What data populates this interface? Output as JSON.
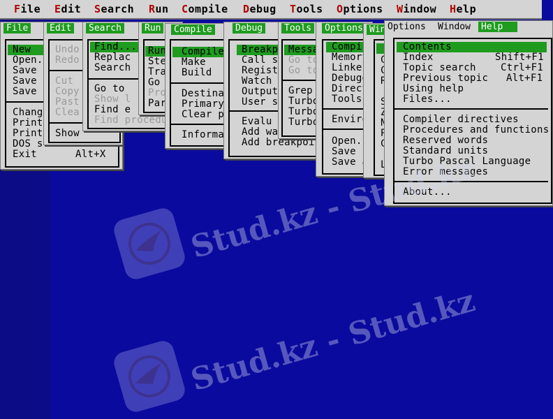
{
  "menubar": {
    "items": [
      {
        "label": "File",
        "hotkey": "F",
        "rest": "ile"
      },
      {
        "label": "Edit",
        "hotkey": "E",
        "rest": "dit"
      },
      {
        "label": "Search",
        "hotkey": "S",
        "rest": "earch"
      },
      {
        "label": "Run",
        "hotkey": "R",
        "rest": "un"
      },
      {
        "label": "Compile",
        "hotkey": "C",
        "rest": "ompile"
      },
      {
        "label": "Debug",
        "hotkey": "D",
        "rest": "ebug"
      },
      {
        "label": "Tools",
        "hotkey": "T",
        "rest": "ools"
      },
      {
        "label": "Options",
        "hotkey": "O",
        "rest": "ptions"
      },
      {
        "label": "Window",
        "hotkey": "W",
        "rest": "indow"
      },
      {
        "label": "Help",
        "hotkey": "H",
        "rest": "elp"
      }
    ]
  },
  "windows": {
    "file": {
      "title": "File",
      "items": [
        "New",
        "Open.",
        "Save",
        "Save",
        "Save",
        "Chang",
        "Print",
        "Print",
        "DOS s",
        "Exit"
      ],
      "exit_shortcut": "Alt+X"
    },
    "edit": {
      "title": "Edit",
      "items": [
        "Undo",
        "Redo",
        "Cut",
        "Copy",
        "Past",
        "Clea",
        "Show"
      ]
    },
    "search": {
      "title": "Search",
      "items": [
        "Find...",
        "Replac",
        "Search",
        "Go to",
        "Show l",
        "Find e",
        "Find procedu"
      ]
    },
    "run": {
      "title": "Run",
      "items": [
        "Run",
        "Ste",
        "Tra",
        "Go",
        "Pro",
        "Par"
      ]
    },
    "compile": {
      "title": "Compile",
      "items": [
        "Compile",
        "Make",
        "Build",
        "Destina",
        "Primary",
        "Clear p",
        "Informa"
      ]
    },
    "debug": {
      "title": "Debug",
      "items": [
        "Breakp",
        "Call s",
        "Regist",
        "Watch",
        "Output",
        "User s",
        "Evalu",
        "Add wa...",
        "Add breakpoi"
      ]
    },
    "tools": {
      "title": "Tools",
      "items": [
        "Messa",
        "Go to",
        "Go to",
        "Grep",
        "Turbo",
        "Turbo",
        "Turbo"
      ]
    },
    "options": {
      "title": "Options",
      "items": [
        "Compi",
        "Memory",
        "Linker",
        "Debugg",
        "Direct",
        "Tools",
        "Enviro",
        "Open.",
        "Save",
        "Save a"
      ]
    },
    "window": {
      "title": "Window",
      "items": [
        "C",
        "C",
        "R",
        "S",
        "Z",
        "N",
        "P",
        "C",
        "L"
      ]
    },
    "help": {
      "title_tabs": [
        "Options",
        "Window",
        "Help"
      ],
      "items": [
        {
          "label": "Contents",
          "shortcut": ""
        },
        {
          "label": "Index",
          "shortcut": "Shift+F1"
        },
        {
          "label": "Topic search",
          "shortcut": "Ctrl+F1"
        },
        {
          "label": "Previous topic",
          "shortcut": "Alt+F1"
        },
        {
          "label": "Using help",
          "shortcut": ""
        },
        {
          "label": "Files...",
          "shortcut": ""
        },
        {
          "label": "Compiler directives",
          "shortcut": ""
        },
        {
          "label": "Procedures and functions",
          "shortcut": ""
        },
        {
          "label": "Reserved words",
          "shortcut": ""
        },
        {
          "label": "Standard units",
          "shortcut": ""
        },
        {
          "label": "Turbo Pascal Language",
          "shortcut": ""
        },
        {
          "label": "Error messages",
          "shortcut": ""
        },
        {
          "label": "About...",
          "shortcut": ""
        }
      ]
    }
  },
  "watermark": {
    "text": "Stud.kz - Stud.kz"
  },
  "colors": {
    "desktop": "#0a0a9e",
    "menu_bg": "#d4d4d4",
    "highlight": "#1f9b1f",
    "hotkey": "#b00000"
  }
}
